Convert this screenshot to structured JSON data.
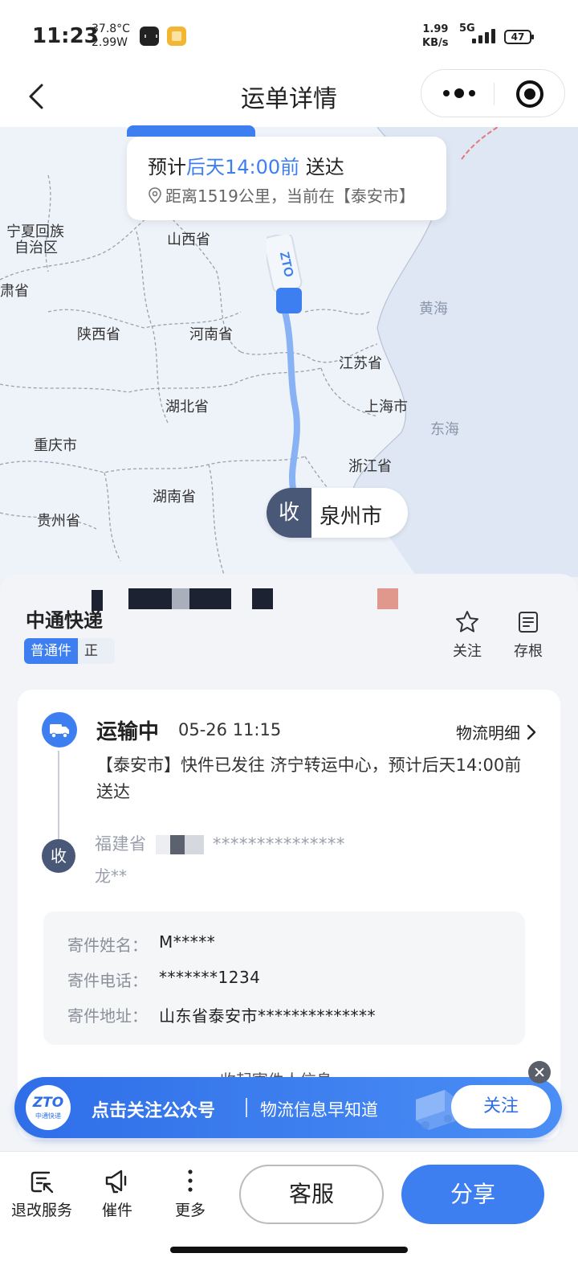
{
  "status_bar": {
    "time": "11:23",
    "temperature": "37.8°C",
    "power": "2.99W",
    "net_speed": "1.99",
    "net_unit": "KB/s",
    "network": "5G",
    "battery": "47"
  },
  "navbar": {
    "title": "运单详情"
  },
  "map": {
    "eta_prefix": "预计",
    "eta_highlight": "后天14:00前",
    "eta_suffix": "送达",
    "distance_text": "距离1519公里，当前在【泰安市】",
    "truck_logo": "ZTO",
    "receiver_badge": "收",
    "receiver_city": "泉州市",
    "labels": {
      "ningxia_1": "宁夏回族",
      "ningxia_2": "自治区",
      "gansu": "肃省",
      "shanxi": "山西省",
      "shaanxi": "陕西省",
      "henan": "河南省",
      "huanghai": "黄海",
      "jiangsu": "江苏省",
      "hubei": "湖北省",
      "shanghai": "上海市",
      "donghai": "东海",
      "chongqing": "重庆市",
      "zhejiang": "浙江省",
      "hunan": "湖南省",
      "guizhou": "贵州省"
    }
  },
  "parcel": {
    "carrier": "中通快递",
    "tag_type": "普通件",
    "tag_extra": "正",
    "actions": {
      "follow": "关注",
      "stub": "存根"
    }
  },
  "tracking": {
    "status": "运输中",
    "time": "05-26 11:15",
    "detail_link": "物流明细",
    "description": "【泰安市】快件已发往 济宁转运中心，预计后天14:00前送达",
    "receiver_badge": "收",
    "receiver_address": "福建省",
    "receiver_address_mask": "***************",
    "receiver_name": "龙**"
  },
  "sender": {
    "name_label": "寄件姓名：",
    "name_value": "M*****",
    "phone_label": "寄件电话：",
    "phone_value": "*******1234",
    "address_label": "寄件地址：",
    "address_value": "山东省泰安市**************",
    "collapse_text": "收起寄件人信息"
  },
  "banner": {
    "logo_text": "ZTO",
    "logo_sub": "中通快递",
    "title": "点击关注公众号",
    "subtitle": "物流信息早知道",
    "button": "关注"
  },
  "bottom_bar": {
    "refund": "退改服务",
    "urge": "催件",
    "more": "更多",
    "service": "客服",
    "share": "分享"
  },
  "colors": {
    "accent": "#3d7ff0",
    "receiver_badge": "#4a5878"
  }
}
